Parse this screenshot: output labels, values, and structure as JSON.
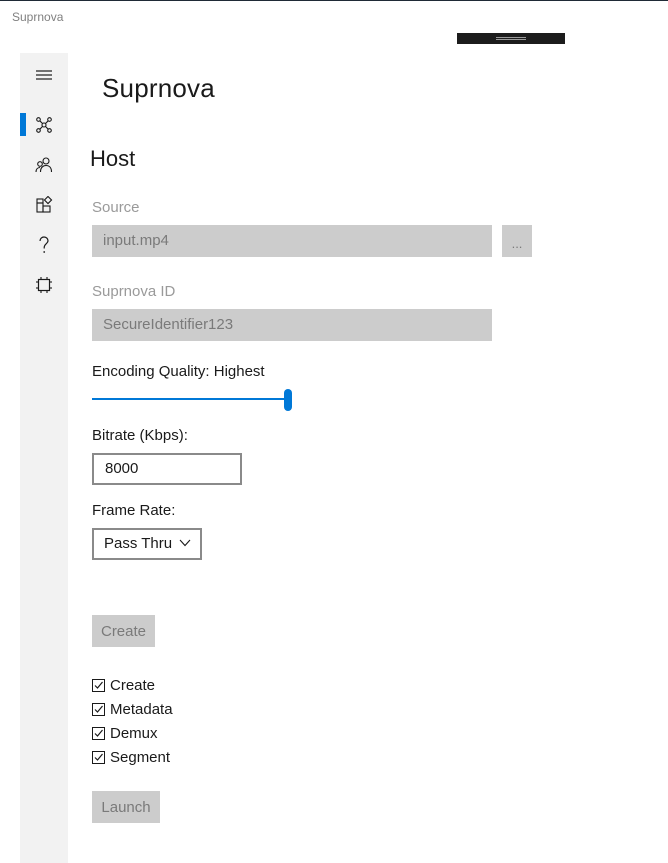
{
  "window": {
    "title": "Suprnova"
  },
  "nav": {
    "items": [
      {
        "name": "hamburger-menu-icon",
        "selected": false
      },
      {
        "name": "network-nodes-icon",
        "selected": true
      },
      {
        "name": "people-icon",
        "selected": false
      },
      {
        "name": "package-icon",
        "selected": false
      },
      {
        "name": "help-question-icon",
        "selected": false
      },
      {
        "name": "chip-icon",
        "selected": false
      }
    ],
    "accent_color": "#0078d7"
  },
  "app_title": "Suprnova",
  "page_title": "Host",
  "form": {
    "source": {
      "label": "Source",
      "value": "input.mp4",
      "browse_label": "..."
    },
    "suprnova_id": {
      "label": "Suprnova ID",
      "value": "SecureIdentifier123"
    },
    "encoding_quality": {
      "label": "Encoding Quality: Highest",
      "slider_fraction": 1.0
    },
    "bitrate": {
      "label": "Bitrate (Kbps):",
      "value": "8000"
    },
    "frame_rate": {
      "label": "Frame Rate:",
      "selected": "Pass Thru"
    },
    "create_button": "Create",
    "steps": [
      {
        "label": "Create",
        "checked": true
      },
      {
        "label": "Metadata",
        "checked": true
      },
      {
        "label": "Demux",
        "checked": true
      },
      {
        "label": "Segment",
        "checked": true
      }
    ],
    "launch_button": "Launch"
  }
}
